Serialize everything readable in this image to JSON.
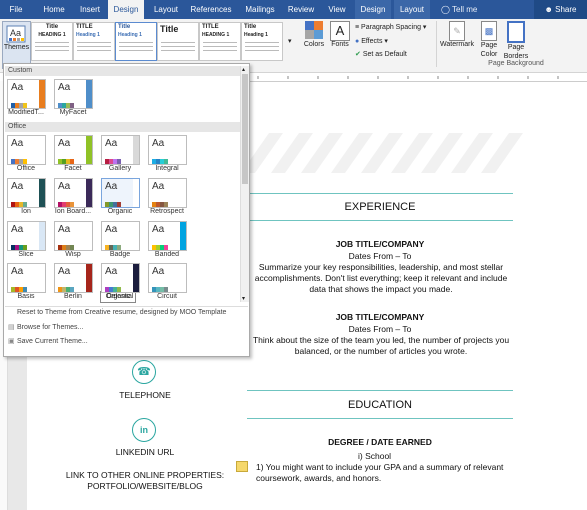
{
  "tabs": [
    {
      "label": "File",
      "active": false,
      "ctx": false
    },
    {
      "label": "Home",
      "active": false,
      "ctx": false
    },
    {
      "label": "Insert",
      "active": false,
      "ctx": false
    },
    {
      "label": "Design",
      "active": true,
      "ctx": false
    },
    {
      "label": "Layout",
      "active": false,
      "ctx": false
    },
    {
      "label": "References",
      "active": false,
      "ctx": false
    },
    {
      "label": "Mailings",
      "active": false,
      "ctx": false
    },
    {
      "label": "Review",
      "active": false,
      "ctx": false
    },
    {
      "label": "View",
      "active": false,
      "ctx": false
    },
    {
      "label": "Design",
      "active": false,
      "ctx": true
    },
    {
      "label": "Layout",
      "active": false,
      "ctx": true
    }
  ],
  "tell_me": "Tell me",
  "share": "Share",
  "ribbon": {
    "themes_label": "Themes",
    "styles": [
      {
        "title": "Title",
        "sub": "HEADING 1"
      },
      {
        "title": "TITLE",
        "sub": "Heading 1"
      },
      {
        "title": "Title",
        "sub": "Heading 1"
      },
      {
        "title": "Title",
        "sub": ""
      },
      {
        "title": "TITLE",
        "sub": "HEADING 1"
      },
      {
        "title": "Title",
        "sub": "Heading 1"
      }
    ],
    "colors_label": "Colors",
    "fonts_label": "Fonts",
    "paragraph_spacing": "Paragraph Spacing",
    "effects": "Effects",
    "set_default": "Set as Default",
    "watermark": "Watermark",
    "page_color": "Page Color",
    "page_borders": "Page Borders",
    "group_label": "Page Background"
  },
  "dropdown": {
    "custom_header": "Custom",
    "office_header": "Office",
    "custom_themes": [
      {
        "label": "ModifiedT...",
        "colors": [
          "#1f5fa8",
          "#e87d1e",
          "#a5a5a5",
          "#f0c419"
        ],
        "side": "#e87d1e"
      },
      {
        "label": "MyFacet",
        "colors": [
          "#4f8ec9",
          "#2aa6a0",
          "#9bbb59",
          "#7f6084"
        ],
        "side": "#4f8ec9"
      }
    ],
    "office_themes": [
      {
        "label": "Office",
        "colors": [
          "#4472c4",
          "#ed7d31",
          "#a5a5a5",
          "#ffc000"
        ],
        "side": "#ffffff"
      },
      {
        "label": "Facet",
        "colors": [
          "#90c226",
          "#54a021",
          "#e6b91e",
          "#e76618"
        ],
        "side": "#90c226"
      },
      {
        "label": "Gallery",
        "colors": [
          "#b71e42",
          "#de478e",
          "#bc72f0",
          "#795faf"
        ],
        "side": "#d9d9d9"
      },
      {
        "label": "Integral",
        "colors": [
          "#1cade4",
          "#2683c6",
          "#27ced7",
          "#42ba97"
        ],
        "side": "#ffffff"
      },
      {
        "label": "Ion",
        "colors": [
          "#b01513",
          "#ea6312",
          "#e6b729",
          "#6aac90"
        ],
        "side": "#1e5155"
      },
      {
        "label": "Ion Board...",
        "colors": [
          "#b31166",
          "#e33d6f",
          "#e45f3c",
          "#e9943a"
        ],
        "side": "#3b2a59"
      },
      {
        "label": "Organic",
        "colors": [
          "#83992a",
          "#3c9770",
          "#44709d",
          "#a23c33"
        ],
        "side": "#ffffff"
      },
      {
        "label": "Retrospect",
        "colors": [
          "#e48312",
          "#bd582c",
          "#865640",
          "#9b8357"
        ],
        "side": "#ffffff"
      },
      {
        "label": "Slice",
        "colors": [
          "#052f61",
          "#a50e82",
          "#14967c",
          "#6a9e1f"
        ],
        "side": "#d9e7f5"
      },
      {
        "label": "Wisp",
        "colors": [
          "#a53010",
          "#de7e18",
          "#9f8351",
          "#728653"
        ],
        "side": "#ffffff"
      },
      {
        "label": "Badge",
        "colors": [
          "#f8b323",
          "#656a59",
          "#46b2b5",
          "#8caa7e"
        ],
        "side": "#ffffff"
      },
      {
        "label": "Banded",
        "colors": [
          "#ffc000",
          "#a5d028",
          "#08cc78",
          "#f24099"
        ],
        "side": "#00a3e0"
      },
      {
        "label": "Basis",
        "colors": [
          "#a6b727",
          "#df5327",
          "#fe9e00",
          "#418ab3"
        ],
        "side": "#ffffff"
      },
      {
        "label": "Berlin",
        "colors": [
          "#f09415",
          "#c1b56b",
          "#4baf73",
          "#5aa6c0"
        ],
        "side": "#a6251b"
      },
      {
        "label": "Celestial",
        "colors": [
          "#ac3ec1",
          "#477bd1",
          "#46b298",
          "#90ba4c"
        ],
        "side": "#1b1d3d"
      },
      {
        "label": "Circuit",
        "colors": [
          "#3494ba",
          "#58b6c0",
          "#75bda7",
          "#7a8c8e"
        ],
        "side": "#ffffff"
      }
    ],
    "tooltip": "Organic",
    "reset_link": "Reset to Theme from Creative resume, designed by MOO Template",
    "browse_link": "Browse for Themes...",
    "save_link": "Save Current Theme..."
  },
  "document": {
    "experience_head": "EXPERIENCE",
    "job1_title": "JOB TITLE/COMPANY",
    "job1_dates": "Dates From – To",
    "job1_text": "Summarize your key responsibilities, leadership, and most stellar accomplishments. Don't list everything; keep it relevant and include data that shows the impact you made.",
    "job2_title": "JOB TITLE/COMPANY",
    "job2_dates": "Dates From – To",
    "job2_text": "Think about the size of the team you led, the number of projects you balanced, or the number of articles you wrote.",
    "education_head": "EDUCATION",
    "degree": "DEGREE / DATE EARNED",
    "school_item": "i)      School",
    "edu_item_1": "1)    You might want to include your GPA and a summary of relevant coursework, awards, and honors.",
    "telephone": "TELEPHONE",
    "linkedin": "LINKEDIN URL",
    "other_props": "LINK TO OTHER ONLINE PROPERTIES: PORTFOLIO/WEBSITE/BLOG"
  }
}
